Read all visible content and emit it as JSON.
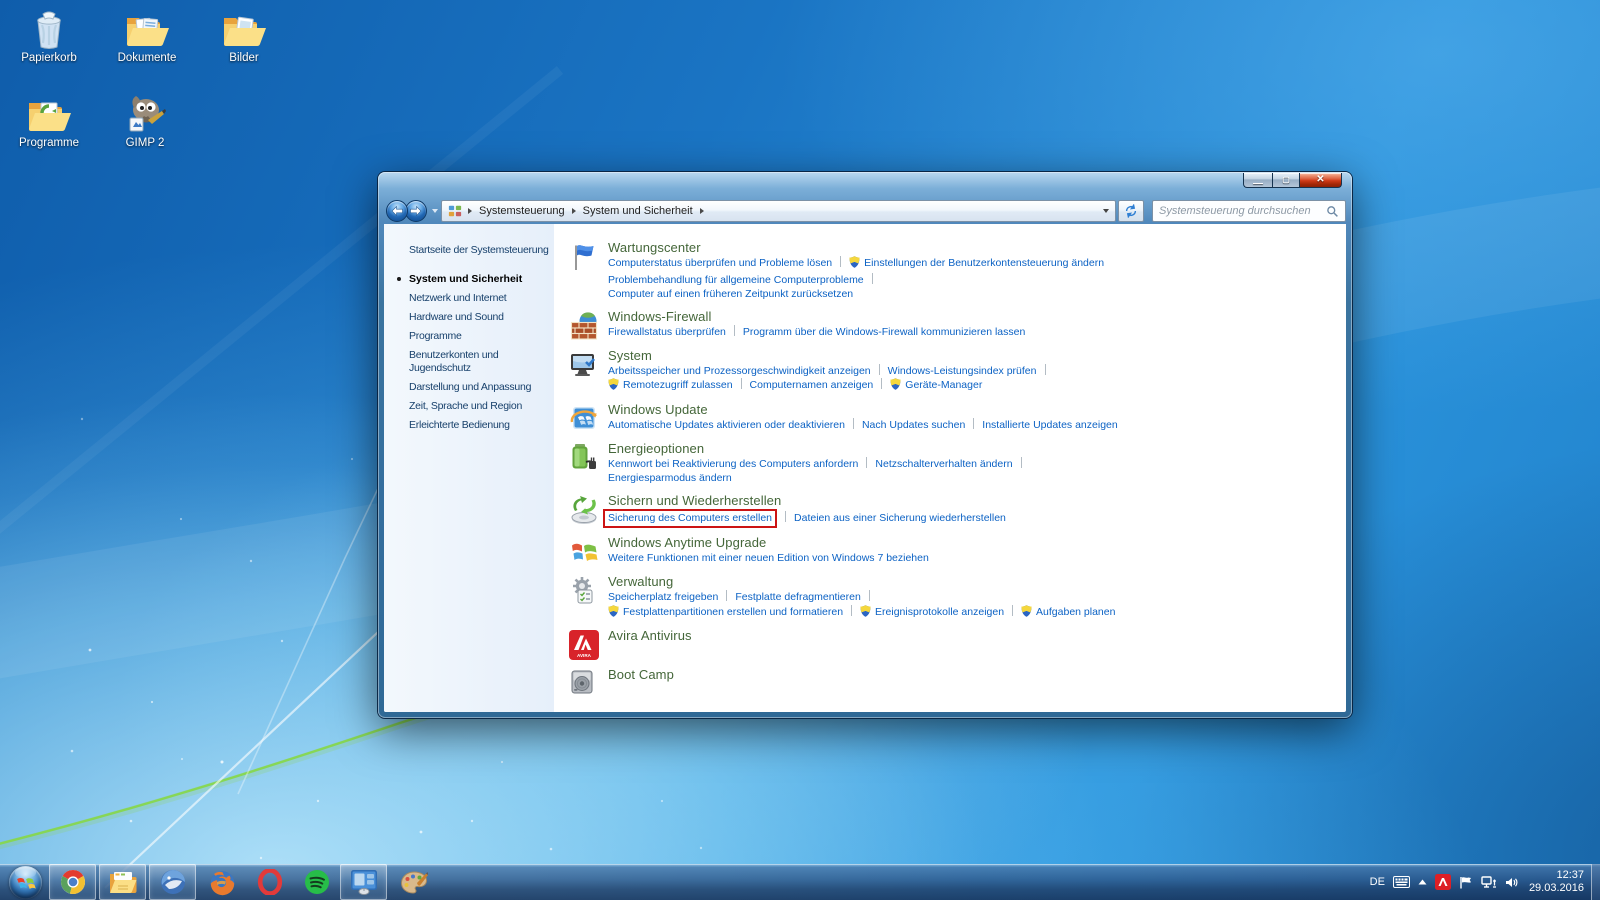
{
  "colors": {
    "header_green": "#446639",
    "link_blue": "#0c62c4",
    "highlight_red": "#cc1414",
    "sidebar_text": "#17406b"
  },
  "desktop": {
    "icons": [
      {
        "label": "Papierkorb",
        "icon": "recycle"
      },
      {
        "label": "Dokumente",
        "icon": "folder-docs"
      },
      {
        "label": "Bilder",
        "icon": "folder-pics"
      },
      {
        "label": "Programme",
        "icon": "folder-prog"
      },
      {
        "label": "GIMP 2",
        "icon": "gimp"
      }
    ]
  },
  "window": {
    "breadcrumb": [
      "Systemsteuerung",
      "System und Sicherheit"
    ],
    "search_placeholder": "Systemsteuerung durchsuchen",
    "sidebar": {
      "home": "Startseite der Systemsteuerung",
      "items": [
        {
          "label": "System und Sicherheit",
          "active": true
        },
        {
          "label": "Netzwerk und Internet",
          "active": false
        },
        {
          "label": "Hardware und Sound",
          "active": false
        },
        {
          "label": "Programme",
          "active": false
        },
        {
          "label": "Benutzerkonten und Jugendschutz",
          "active": false
        },
        {
          "label": "Darstellung und Anpassung",
          "active": false
        },
        {
          "label": "Zeit, Sprache und Region",
          "active": false
        },
        {
          "label": "Erleichterte Bedienung",
          "active": false
        }
      ]
    },
    "sections": [
      {
        "title": "Wartungscenter",
        "icon": "flag",
        "rows": [
          {
            "links": [
              {
                "label": "Computerstatus überprüfen und Probleme lösen"
              },
              {
                "label": "Einstellungen der Benutzerkontensteuerung ändern",
                "shield": true
              }
            ]
          },
          {
            "links": [
              {
                "label": "Problembehandlung für allgemeine Computerprobleme"
              }
            ],
            "trail": true
          },
          {
            "links": [
              {
                "label": "Computer auf einen früheren Zeitpunkt zurücksetzen"
              }
            ]
          }
        ]
      },
      {
        "title": "Windows-Firewall",
        "icon": "firewall",
        "rows": [
          {
            "links": [
              {
                "label": "Firewallstatus überprüfen"
              },
              {
                "label": "Programm über die Windows-Firewall kommunizieren lassen"
              }
            ]
          }
        ]
      },
      {
        "title": "System",
        "icon": "system",
        "rows": [
          {
            "links": [
              {
                "label": "Arbeitsspeicher und Prozessorgeschwindigkeit anzeigen"
              },
              {
                "label": "Windows-Leistungsindex prüfen"
              }
            ],
            "trail": true
          },
          {
            "links": [
              {
                "label": "Remotezugriff zulassen",
                "shield": true
              },
              {
                "label": "Computernamen anzeigen"
              },
              {
                "label": "Geräte-Manager",
                "shield": true
              }
            ]
          }
        ]
      },
      {
        "title": "Windows Update",
        "icon": "update",
        "rows": [
          {
            "links": [
              {
                "label": "Automatische Updates aktivieren oder deaktivieren"
              },
              {
                "label": "Nach Updates suchen"
              },
              {
                "label": "Installierte Updates anzeigen"
              }
            ]
          }
        ]
      },
      {
        "title": "Energieoptionen",
        "icon": "energy",
        "rows": [
          {
            "links": [
              {
                "label": "Kennwort bei Reaktivierung des Computers anfordern"
              },
              {
                "label": "Netzschalterverhalten ändern"
              }
            ],
            "trail": true
          },
          {
            "links": [
              {
                "label": "Energiesparmodus ändern"
              }
            ]
          }
        ]
      },
      {
        "title": "Sichern und Wiederherstellen",
        "icon": "backup",
        "rows": [
          {
            "links": [
              {
                "label": "Sicherung des Computers erstellen",
                "boxed": true
              },
              {
                "label": "Dateien aus einer Sicherung wiederherstellen"
              }
            ]
          }
        ]
      },
      {
        "title": "Windows Anytime Upgrade",
        "icon": "anytime",
        "rows": [
          {
            "links": [
              {
                "label": "Weitere Funktionen mit einer neuen Edition von Windows 7 beziehen"
              }
            ]
          }
        ]
      },
      {
        "title": "Verwaltung",
        "icon": "admin",
        "rows": [
          {
            "links": [
              {
                "label": "Speicherplatz freigeben"
              },
              {
                "label": "Festplatte defragmentieren"
              }
            ],
            "trail": true
          },
          {
            "links": [
              {
                "label": "Festplattenpartitionen erstellen und formatieren",
                "shield": true
              },
              {
                "label": "Ereignisprotokolle anzeigen",
                "shield": true
              },
              {
                "label": "Aufgaben planen",
                "shield": true
              }
            ]
          }
        ]
      },
      {
        "title": "Avira Antivirus",
        "icon": "avira",
        "rows": []
      },
      {
        "title": "Boot Camp",
        "icon": "bootcamp",
        "rows": []
      }
    ]
  },
  "taskbar": {
    "apps": [
      {
        "name": "chrome",
        "open": true
      },
      {
        "name": "explorer",
        "open": true
      },
      {
        "name": "thunderbird",
        "open": true
      },
      {
        "name": "firefox",
        "open": false
      },
      {
        "name": "opera",
        "open": false
      },
      {
        "name": "spotify",
        "open": false
      },
      {
        "name": "display",
        "open": true
      },
      {
        "name": "paint",
        "open": false
      }
    ],
    "tray": {
      "language": "DE",
      "time": "12:37",
      "date": "29.03.2016"
    }
  }
}
